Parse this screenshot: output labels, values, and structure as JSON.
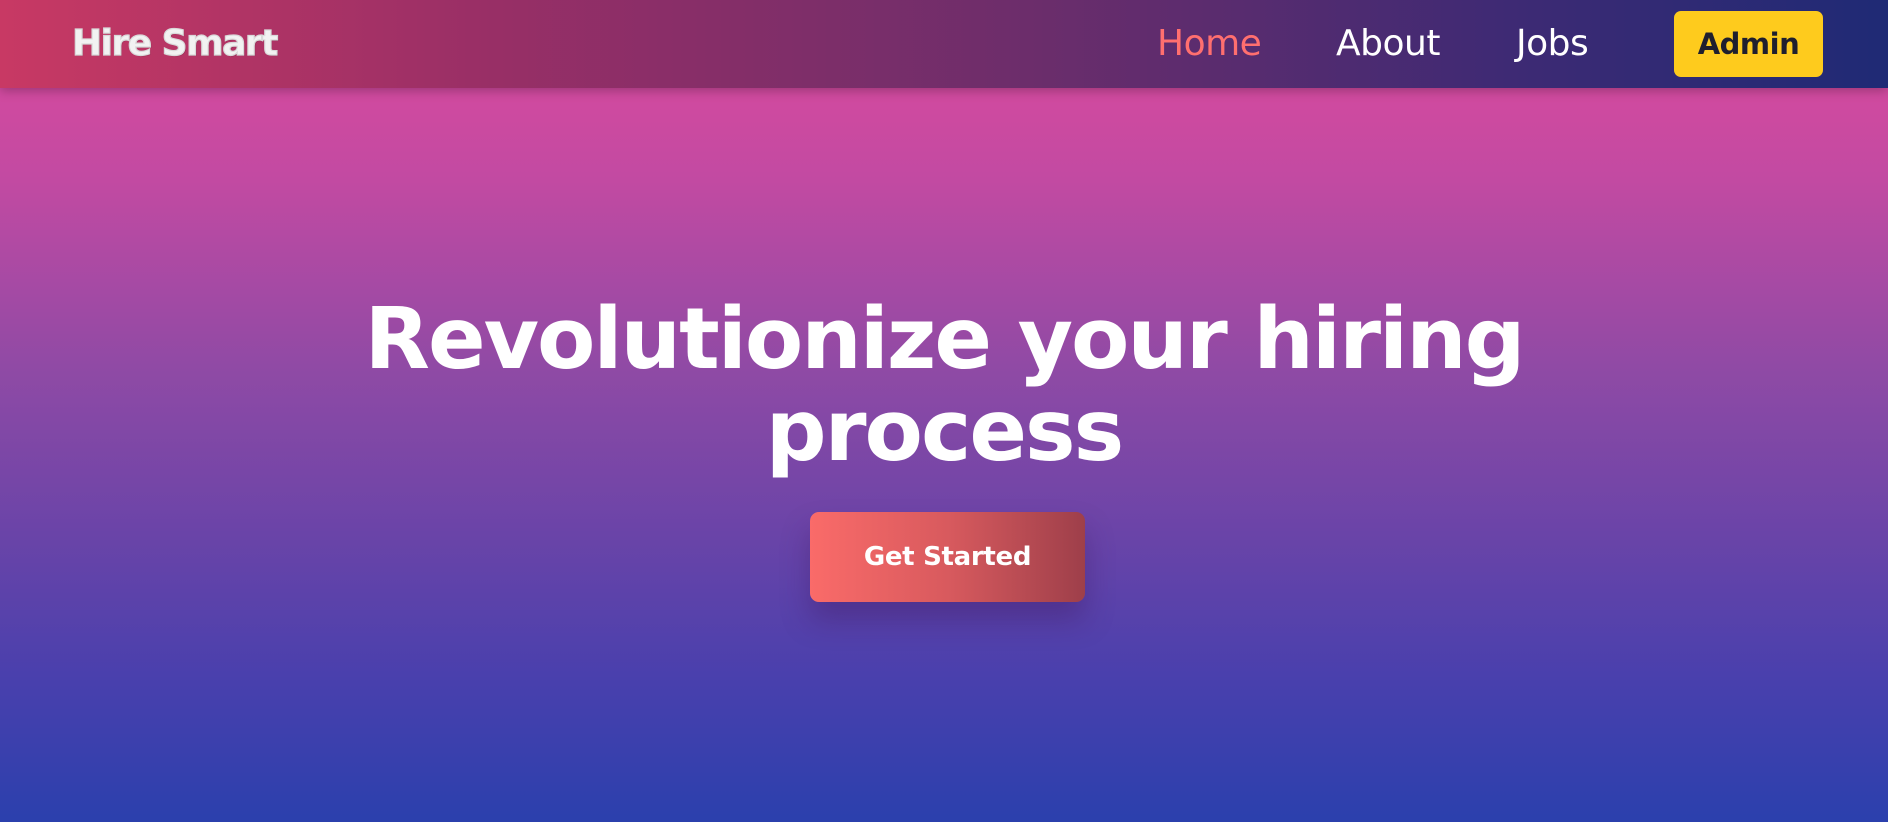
{
  "header": {
    "logo_text": "Hire Smart",
    "nav": {
      "home_label": "Home",
      "about_label": "About",
      "jobs_label": "Jobs"
    },
    "admin_label": "Admin"
  },
  "hero": {
    "title": "Revolutionize your hiring process",
    "cta_label": "Get Started"
  },
  "colors": {
    "active_nav": "#ff6f6f",
    "admin_button": "#fecb1d",
    "cta_start": "#fa6b69",
    "cta_end": "#9e3f4a",
    "header_left": "#c83964",
    "header_right": "#1f2a75",
    "hero_top": "#df4a9c",
    "hero_bottom": "#2b40ad"
  }
}
